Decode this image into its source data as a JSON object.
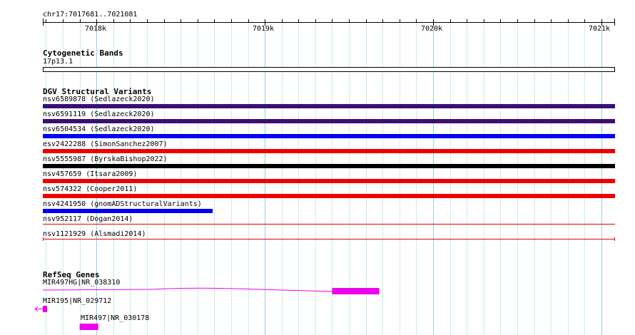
{
  "browser": {
    "location": "chr17:7017681..7021081",
    "ruler_ticks": [
      "7018k",
      "7019k",
      "7020k",
      "7021k"
    ]
  },
  "tracks": {
    "cytoband": {
      "title": "Cytogenetic Bands",
      "band": "17p13.1"
    },
    "dgv": {
      "title": "DGV Structural Variants",
      "features": [
        {
          "label": "nsv6589878 (Sedlazeck2020)",
          "color": "#3a0f75",
          "start": 7017681,
          "end": 7021081
        },
        {
          "label": "nsv6591119 (Sedlazeck2020)",
          "color": "#3a0f75",
          "start": 7017681,
          "end": 7021081
        },
        {
          "label": "nsv6504534 (Sedlazeck2020)",
          "color": "#0000ee",
          "start": 7017681,
          "end": 7021081
        },
        {
          "label": "esv2422288 (SimonSanchez2007)",
          "color": "#ee0000",
          "start": 7017681,
          "end": 7021081
        },
        {
          "label": "nsv5555987 (ByrskaBishop2022)",
          "color": "#000000",
          "start": 7017681,
          "end": 7021081
        },
        {
          "label": "nsv457659 (Itsara2009)",
          "color": "#ee0000",
          "start": 7017681,
          "end": 7021081
        },
        {
          "label": "nsv574322 (Cooper2011)",
          "color": "#ee0000",
          "start": 7017681,
          "end": 7021081
        },
        {
          "label": "nsv4241950 (gnomADStructuralVariants)",
          "color": "#0000ee",
          "start": 7017681,
          "end": 7018690
        },
        {
          "label": "nsv952117 (Dogan2014)",
          "color": "#ee0000",
          "start": 7017681,
          "end": 7021081
        },
        {
          "label": "nsv1121929 (Alsmadi2014)",
          "color": "#ee0000",
          "start": 7017681,
          "end": 7021081
        }
      ]
    },
    "refseq": {
      "title": "RefSeq Genes",
      "color": "#ee00ee",
      "genes": [
        {
          "label": "MIR497HG|NR_038310",
          "start": 7017681,
          "end": 7020000,
          "exon_start": 7019400,
          "exon_end": 7019680
        },
        {
          "label": "MIR195|NR_029712",
          "start": 7017681,
          "end": 7017700
        },
        {
          "label": "MIR497|NR_030178",
          "start": 7017900,
          "end": 7018010
        }
      ]
    }
  },
  "scale": {
    "start": 7017681,
    "end": 7021081
  }
}
